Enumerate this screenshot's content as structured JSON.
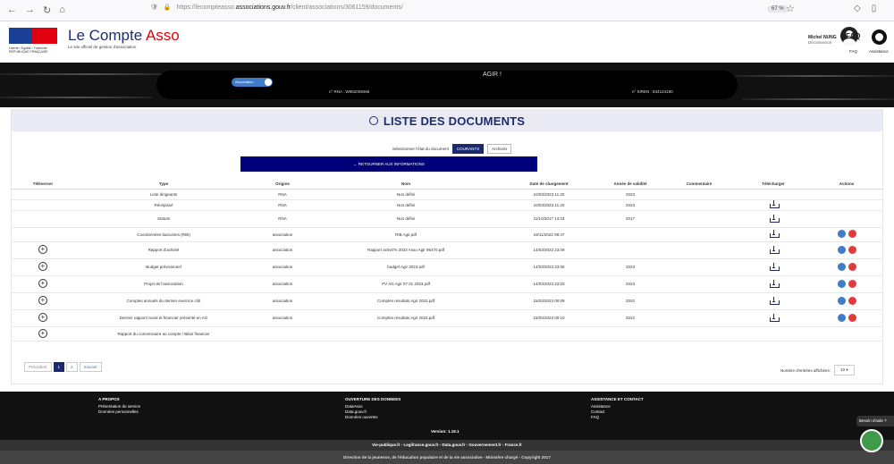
{
  "browser": {
    "url_prefix": "https://lecompteasso.",
    "url_host": "associations.gouv.fr",
    "url_path": "/client/associations/3061159/documents/",
    "zoom": "67 %"
  },
  "header": {
    "brand_main": "Le Compte ",
    "brand_accent": "Asso",
    "subtitle": "Le site officiel de gestion d'association",
    "republic": "Liberté • Égalité • Fraternité RÉPUBLIQUE FRANÇAISE",
    "user_name": "Michel NUNG",
    "user_action": "Déconnexion",
    "faq_icon": "FAQ",
    "faq_label": "FAQ",
    "assistance_label": "Assistance"
  },
  "banner": {
    "toggle_label": "Association",
    "rna": "n° RNA : W952008466",
    "association_name": "AGIR !",
    "siren": "n° SIREN : 834124190"
  },
  "page": {
    "title": "LISTE DES DOCUMENTS",
    "state_prompt": "Sélectionner l'état du document",
    "state_current": "COURANTS",
    "state_archived": "Archivés",
    "back_button": "← RETOURNER AUX INFORMATIONS"
  },
  "table": {
    "headers": [
      "Téléverser",
      "Type",
      "Origine",
      "Nom",
      "Date de chargement",
      "Année de validité",
      "Commentaire",
      "Télécharger",
      "Actions"
    ],
    "rows": [
      {
        "upload": false,
        "type": "Liste dirigeants",
        "origine": "RNA",
        "nom": "Non défini",
        "date": "10/03/2023 11:20",
        "annee": "2023",
        "download": false,
        "actions": false
      },
      {
        "upload": false,
        "type": "Récépissé",
        "origine": "RNA",
        "nom": "Non défini",
        "date": "10/03/2023 11:20",
        "annee": "2023",
        "download": true,
        "actions": false
      },
      {
        "upload": false,
        "type": "Statuts",
        "origine": "RNA",
        "nom": "Non défini",
        "date": "11/10/2017 14:23",
        "annee": "2017",
        "download": true,
        "actions": false
      },
      {
        "upload": false,
        "type": "Coordonnées bancaires (RIB)",
        "origine": "association",
        "nom": "RIB Agir.pdf",
        "date": "19/11/2022 08:47",
        "annee": "",
        "download": true,
        "actions": true
      },
      {
        "upload": true,
        "type": "Rapport d'activité",
        "origine": "association",
        "nom": "Rapport activit?s 2022 Asso Agir 95470.pdf",
        "date": "14/03/2023 23:09",
        "annee": "",
        "download": true,
        "actions": true
      },
      {
        "upload": true,
        "type": "Budget prévisionnel",
        "origine": "association",
        "nom": "budget Agir 2023.pdf",
        "date": "14/03/2023 23:05",
        "annee": "2023",
        "download": true,
        "actions": true
      },
      {
        "upload": true,
        "type": "Projet de l'association",
        "origine": "association",
        "nom": "PV AG Agir 07 01 2023.pdf",
        "date": "14/03/2023 23:03",
        "annee": "2023",
        "download": true,
        "actions": true
      },
      {
        "upload": true,
        "type": "Comptes annuels du dernier exercice clôt",
        "origine": "association",
        "nom": "Comptes resultats Agir 2022.pdf",
        "date": "15/03/2023 00:09",
        "annee": "2022",
        "download": true,
        "actions": true
      },
      {
        "upload": true,
        "type": "Dernier rapport moral et financier présenté en AG",
        "origine": "association",
        "nom": "Comptes resultats Agir 2022.pdf",
        "date": "15/03/2023 00:10",
        "annee": "2022",
        "download": true,
        "actions": true
      },
      {
        "upload": true,
        "type": "Rapport du commissaire au compte / Bilan financier",
        "origine": "",
        "nom": "",
        "date": "",
        "annee": "",
        "download": false,
        "actions": false
      }
    ]
  },
  "pagination": {
    "prev": "Précédent",
    "page1": "1",
    "page2": "2",
    "next": "Suivant",
    "entries_label": "Nombre d'entrées affichées:",
    "entries_value": "10 ▾"
  },
  "footer": {
    "col1_title": "A PROPOS",
    "col1_links": [
      "Présentation du service",
      "Données personnelles"
    ],
    "col2_title": "OUVERTURE DES DONNEES",
    "col2_links": [
      "DataAsso",
      "Data.gouv.fr",
      "Données ouvertes"
    ],
    "col3_title": "ASSISTANCE ET CONTACT",
    "col3_links": [
      "Assistance",
      "Contact",
      "FAQ"
    ],
    "version": "Version: 1.19.1",
    "links_bar": "Vie-publique.fr - Legifrance.gouv.fr - Data.gouv.fr - Gouvernement.fr - France.fr",
    "copyright": "Direction de la jeunesse, de l'éducation populaire et de la vie associative - Ministère chargé - Copyright 2017",
    "help_tab": "Besoin d'aide ?"
  }
}
